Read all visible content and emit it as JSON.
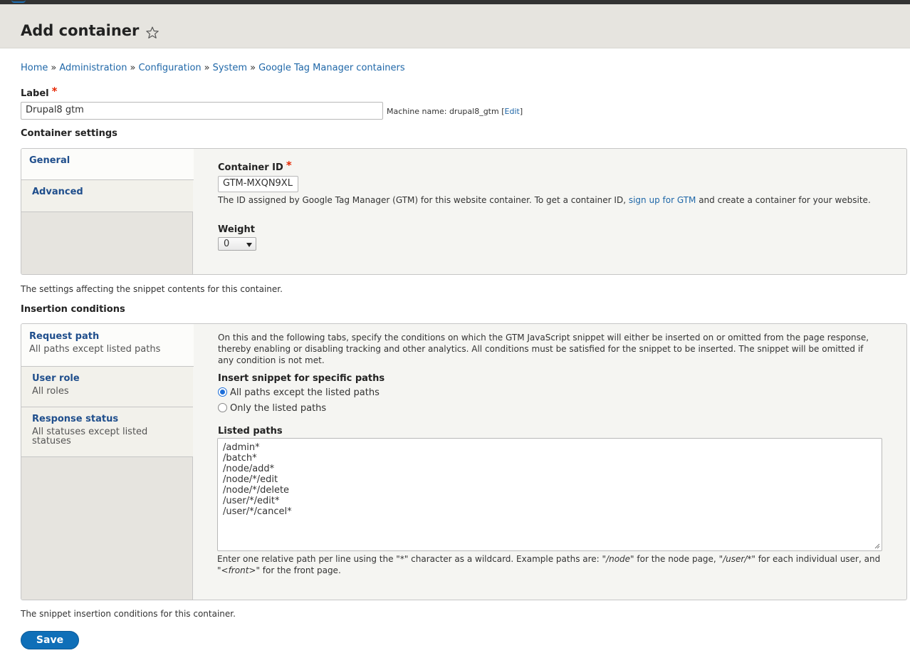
{
  "page": {
    "title": "Add container",
    "breadcrumb": [
      "Home",
      "Administration",
      "Configuration",
      "System",
      "Google Tag Manager containers"
    ],
    "breadcrumb_separator": "»"
  },
  "label_field": {
    "label": "Label",
    "required_mark": "*",
    "value": "Drupal8 gtm",
    "machine_name_prefix": "Machine name: drupal8_gtm",
    "machine_name_edit_open": "[",
    "machine_name_edit": "Edit",
    "machine_name_edit_close": "]"
  },
  "container_settings": {
    "heading": "Container settings",
    "tabs": [
      {
        "label": "General",
        "active": true
      },
      {
        "label": "Advanced",
        "active": false
      }
    ],
    "container_id": {
      "label": "Container ID",
      "required_mark": "*",
      "value": "GTM-MXQN9XL",
      "desc_before": "The ID assigned by Google Tag Manager (GTM) for this website container. To get a container ID,",
      "desc_link": "sign up for GTM",
      "desc_after": "and create a container for your website."
    },
    "weight": {
      "label": "Weight",
      "value": "0"
    },
    "footer": "The settings affecting the snippet contents for this container."
  },
  "insertion_conditions": {
    "heading": "Insertion conditions",
    "tabs": [
      {
        "label": "Request path",
        "summary": "All paths except listed paths",
        "active": true
      },
      {
        "label": "User role",
        "summary": "All roles",
        "active": false
      },
      {
        "label": "Response status",
        "summary": "All statuses except listed statuses",
        "active": false
      }
    ],
    "intro": "On this and the following tabs, specify the conditions on which the GTM JavaScript snippet will either be inserted on or omitted from the page response, thereby enabling or disabling tracking and other analytics. All conditions must be satisfied for the snippet to be inserted. The snippet will be omitted if any condition is not met.",
    "insert_snippet": {
      "label": "Insert snippet for specific paths",
      "options": [
        {
          "label": "All paths except the listed paths",
          "checked": true
        },
        {
          "label": "Only the listed paths",
          "checked": false
        }
      ]
    },
    "listed_paths": {
      "label": "Listed paths",
      "lines": [
        "/admin*",
        "/batch*",
        "/node/add*",
        "/node/*/edit",
        "/node/*/delete",
        "/user/*/edit*",
        "/user/*/cancel*"
      ]
    },
    "paths_help": {
      "t1": "Enter one relative path per line using the \"*\" character as a wildcard. Example paths are: \"",
      "e1": "/node",
      "t2": "\" for the node page, \"",
      "e2": "/user/*",
      "t3": "\" for each individual user, and \"",
      "e3": "<front>",
      "t4": "\" for the front page."
    },
    "footer": "The snippet insertion conditions for this container."
  },
  "actions": {
    "save_label": "Save"
  },
  "colors": {
    "link": "#1f67a8",
    "required": "#e62600",
    "primary_button": "#0f6fb8",
    "header_bg": "#e6e4df"
  }
}
